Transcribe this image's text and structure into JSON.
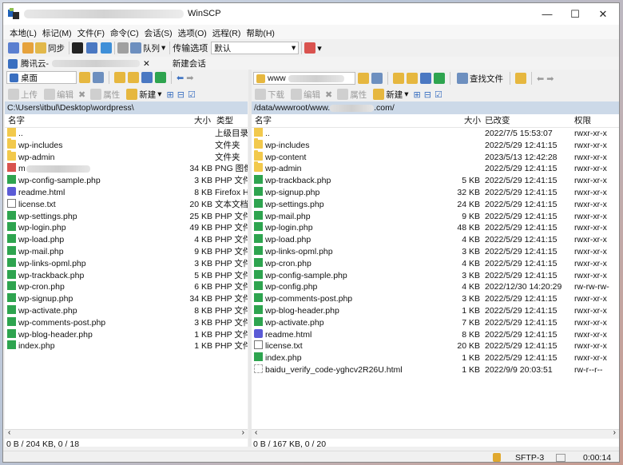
{
  "window": {
    "title": "WinSCP"
  },
  "menu": [
    "本地(L)",
    "标记(M)",
    "文件(F)",
    "命令(C)",
    "会话(S)",
    "选项(O)",
    "远程(R)",
    "帮助(H)"
  ],
  "toolbar": {
    "sync_label": "同步",
    "queue_label": "队列",
    "transfer_options_label": "传输选项",
    "transfer_default": "默认"
  },
  "tabs": {
    "session_prefix": "腾讯云-",
    "new_session": "新建会话"
  },
  "left": {
    "location": "桌面",
    "path": "C:\\Users\\itbul\\Desktop\\wordpress\\",
    "buttons": {
      "upload": "上传",
      "edit": "编辑",
      "properties": "属性",
      "new": "新建"
    },
    "headers": {
      "name": "名字",
      "size": "大小",
      "type": "类型"
    },
    "files": [
      {
        "name": "..",
        "size": "",
        "type": "上级目录",
        "icon": "up"
      },
      {
        "name": "wp-includes",
        "size": "",
        "type": "文件夹",
        "icon": "folder"
      },
      {
        "name": "wp-admin",
        "size": "",
        "type": "文件夹",
        "icon": "folder"
      },
      {
        "name": "m",
        "size": "34 KB",
        "type": "PNG 图像",
        "icon": "png"
      },
      {
        "name": "wp-config-sample.php",
        "size": "3 KB",
        "type": "PHP 文件",
        "icon": "php"
      },
      {
        "name": "readme.html",
        "size": "8 KB",
        "type": "Firefox H",
        "icon": "html"
      },
      {
        "name": "license.txt",
        "size": "20 KB",
        "type": "文本文档",
        "icon": "txt"
      },
      {
        "name": "wp-settings.php",
        "size": "25 KB",
        "type": "PHP 文件",
        "icon": "php"
      },
      {
        "name": "wp-login.php",
        "size": "49 KB",
        "type": "PHP 文件",
        "icon": "php"
      },
      {
        "name": "wp-load.php",
        "size": "4 KB",
        "type": "PHP 文件",
        "icon": "php"
      },
      {
        "name": "wp-mail.php",
        "size": "9 KB",
        "type": "PHP 文件",
        "icon": "php"
      },
      {
        "name": "wp-links-opml.php",
        "size": "3 KB",
        "type": "PHP 文件",
        "icon": "php"
      },
      {
        "name": "wp-trackback.php",
        "size": "5 KB",
        "type": "PHP 文件",
        "icon": "php"
      },
      {
        "name": "wp-cron.php",
        "size": "6 KB",
        "type": "PHP 文件",
        "icon": "php"
      },
      {
        "name": "wp-signup.php",
        "size": "34 KB",
        "type": "PHP 文件",
        "icon": "php"
      },
      {
        "name": "wp-activate.php",
        "size": "8 KB",
        "type": "PHP 文件",
        "icon": "php"
      },
      {
        "name": "wp-comments-post.php",
        "size": "3 KB",
        "type": "PHP 文件",
        "icon": "php"
      },
      {
        "name": "wp-blog-header.php",
        "size": "1 KB",
        "type": "PHP 文件",
        "icon": "php"
      },
      {
        "name": "index.php",
        "size": "1 KB",
        "type": "PHP 文件",
        "icon": "php"
      }
    ],
    "status": "0 B / 204 KB,   0 / 18"
  },
  "right": {
    "location": "www",
    "path_prefix": "/data/wwwroot/www.",
    "path_suffix": ".com/",
    "buttons": {
      "download": "下载",
      "edit": "编辑",
      "properties": "属性",
      "new": "新建",
      "find": "查找文件"
    },
    "headers": {
      "name": "名字",
      "size": "大小",
      "changed": "已改变",
      "rights": "权限"
    },
    "files": [
      {
        "name": "..",
        "size": "",
        "changed": "2022/7/5 15:53:07",
        "rights": "rwxr-xr-x",
        "icon": "up"
      },
      {
        "name": "wp-includes",
        "size": "",
        "changed": "2022/5/29 12:41:15",
        "rights": "rwxr-xr-x",
        "icon": "folder"
      },
      {
        "name": "wp-content",
        "size": "",
        "changed": "2023/5/13 12:42:28",
        "rights": "rwxr-xr-x",
        "icon": "folder"
      },
      {
        "name": "wp-admin",
        "size": "",
        "changed": "2022/5/29 12:41:15",
        "rights": "rwxr-xr-x",
        "icon": "folder"
      },
      {
        "name": "wp-trackback.php",
        "size": "5 KB",
        "changed": "2022/5/29 12:41:15",
        "rights": "rwxr-xr-x",
        "icon": "php"
      },
      {
        "name": "wp-signup.php",
        "size": "32 KB",
        "changed": "2022/5/29 12:41:15",
        "rights": "rwxr-xr-x",
        "icon": "php"
      },
      {
        "name": "wp-settings.php",
        "size": "24 KB",
        "changed": "2022/5/29 12:41:15",
        "rights": "rwxr-xr-x",
        "icon": "php"
      },
      {
        "name": "wp-mail.php",
        "size": "9 KB",
        "changed": "2022/5/29 12:41:15",
        "rights": "rwxr-xr-x",
        "icon": "php"
      },
      {
        "name": "wp-login.php",
        "size": "48 KB",
        "changed": "2022/5/29 12:41:15",
        "rights": "rwxr-xr-x",
        "icon": "php"
      },
      {
        "name": "wp-load.php",
        "size": "4 KB",
        "changed": "2022/5/29 12:41:15",
        "rights": "rwxr-xr-x",
        "icon": "php"
      },
      {
        "name": "wp-links-opml.php",
        "size": "3 KB",
        "changed": "2022/5/29 12:41:15",
        "rights": "rwxr-xr-x",
        "icon": "php"
      },
      {
        "name": "wp-cron.php",
        "size": "4 KB",
        "changed": "2022/5/29 12:41:15",
        "rights": "rwxr-xr-x",
        "icon": "php"
      },
      {
        "name": "wp-config-sample.php",
        "size": "3 KB",
        "changed": "2022/5/29 12:41:15",
        "rights": "rwxr-xr-x",
        "icon": "php"
      },
      {
        "name": "wp-config.php",
        "size": "4 KB",
        "changed": "2022/12/30 14:20:29",
        "rights": "rw-rw-rw-",
        "icon": "php"
      },
      {
        "name": "wp-comments-post.php",
        "size": "3 KB",
        "changed": "2022/5/29 12:41:15",
        "rights": "rwxr-xr-x",
        "icon": "php"
      },
      {
        "name": "wp-blog-header.php",
        "size": "1 KB",
        "changed": "2022/5/29 12:41:15",
        "rights": "rwxr-xr-x",
        "icon": "php"
      },
      {
        "name": "wp-activate.php",
        "size": "7 KB",
        "changed": "2022/5/29 12:41:15",
        "rights": "rwxr-xr-x",
        "icon": "php"
      },
      {
        "name": "readme.html",
        "size": "8 KB",
        "changed": "2022/5/29 12:41:15",
        "rights": "rwxr-xr-x",
        "icon": "html"
      },
      {
        "name": "license.txt",
        "size": "20 KB",
        "changed": "2022/5/29 12:41:15",
        "rights": "rwxr-xr-x",
        "icon": "txt"
      },
      {
        "name": "index.php",
        "size": "1 KB",
        "changed": "2022/5/29 12:41:15",
        "rights": "rwxr-xr-x",
        "icon": "php"
      },
      {
        "name": "baidu_verify_code-yghcv2R26U.html",
        "size": "1 KB",
        "changed": "2022/9/9 20:03:51",
        "rights": "rw-r--r--",
        "icon": "blank"
      }
    ],
    "status": "0 B / 167 KB,   0 / 20"
  },
  "statusbar": {
    "protocol": "SFTP-3",
    "time": "0:00:14"
  }
}
